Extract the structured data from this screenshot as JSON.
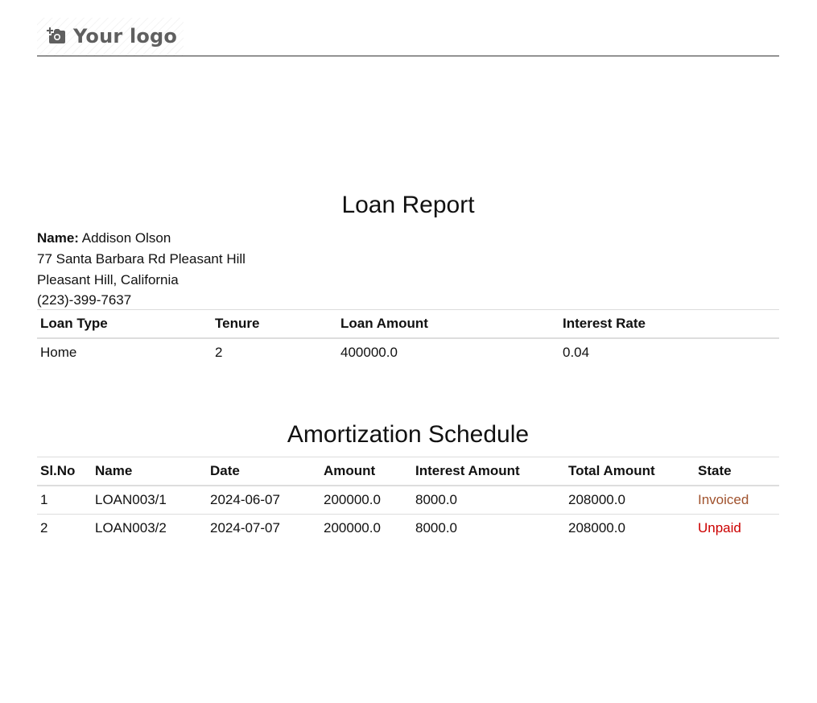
{
  "header": {
    "logo_text": "Your logo",
    "logo_icon": "camera-plus-icon"
  },
  "report": {
    "title": "Loan Report"
  },
  "customer": {
    "name_label": "Name:",
    "name": "Addison Olson",
    "address_line1": "77 Santa Barbara Rd Pleasant Hill",
    "address_line2": "Pleasant Hill, California",
    "phone": "(223)-399-7637"
  },
  "loan_table": {
    "headers": [
      "Loan Type",
      "Tenure",
      "Loan Amount",
      "Interest Rate"
    ],
    "rows": [
      [
        "Home",
        "2",
        "400000.0",
        "0.04"
      ]
    ]
  },
  "schedule": {
    "title": "Amortization Schedule",
    "headers": [
      "Sl.No",
      "Name",
      "Date",
      "Amount",
      "Interest Amount",
      "Total Amount",
      "State"
    ],
    "rows": [
      [
        "1",
        "LOAN003/1",
        "2024-06-07",
        "200000.0",
        "8000.0",
        "208000.0",
        "Invoiced"
      ],
      [
        "2",
        "LOAN003/2",
        "2024-07-07",
        "200000.0",
        "8000.0",
        "208000.0",
        "Unpaid"
      ]
    ]
  },
  "colors": {
    "invoiced": "#a0522d",
    "unpaid": "#cc0000",
    "logo_text": "#5f5f5f"
  }
}
